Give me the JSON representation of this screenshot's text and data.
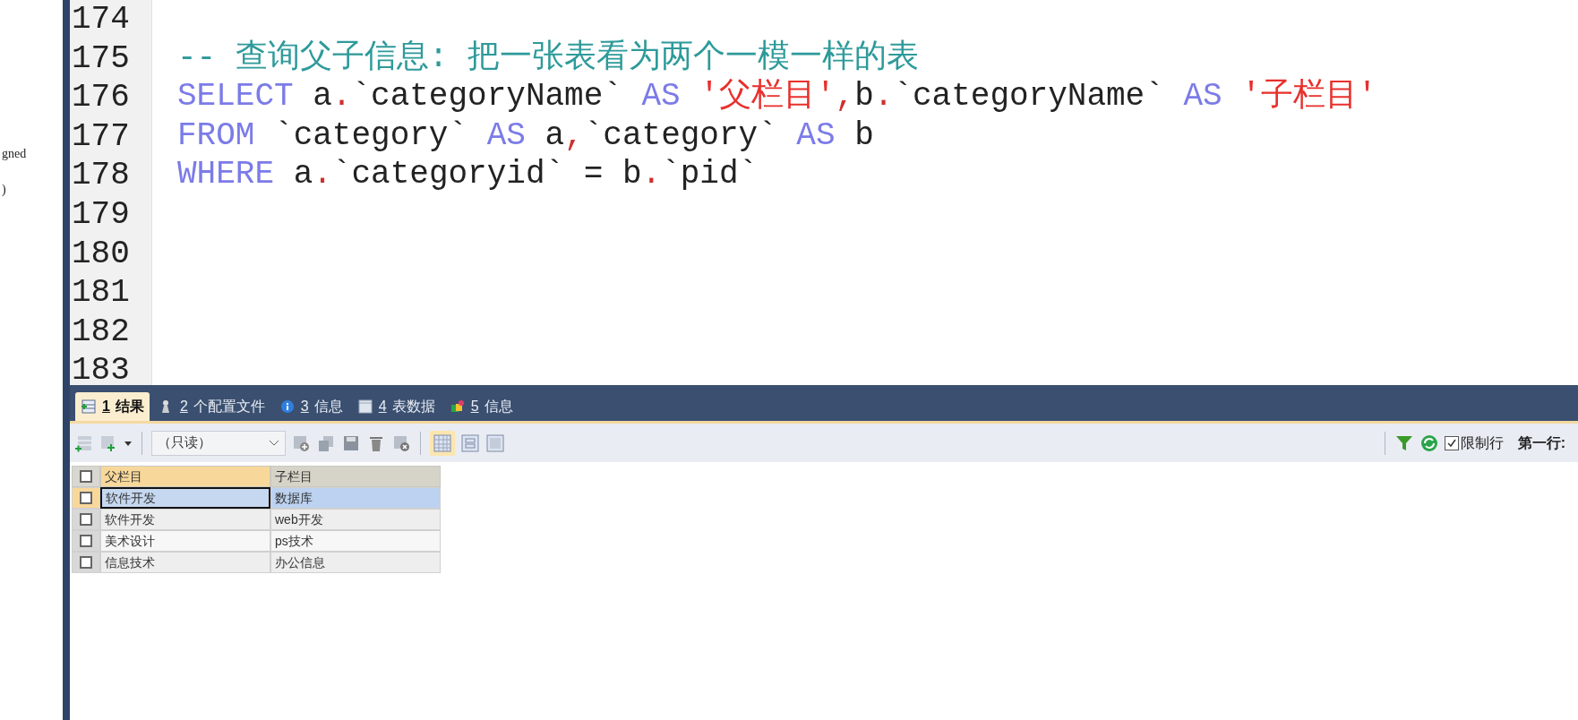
{
  "left_pane": {
    "lines": [
      "gned",
      ")"
    ]
  },
  "editor": {
    "lines": [
      {
        "number": "174"
      },
      {
        "number": "175",
        "tokens": [
          {
            "kind": "comment",
            "text": "-- 查询父子信息: 把一张表看为两个一模一样的表"
          }
        ]
      },
      {
        "number": "176",
        "tokens": [
          {
            "kind": "keyword",
            "text": "SELECT"
          },
          {
            "kind": "plain",
            "text": " a"
          },
          {
            "kind": "punct",
            "text": "."
          },
          {
            "kind": "plain",
            "text": "`categoryName` "
          },
          {
            "kind": "keyword",
            "text": "AS"
          },
          {
            "kind": "string",
            "text": " '父栏目'"
          },
          {
            "kind": "punct",
            "text": ","
          },
          {
            "kind": "plain",
            "text": "b"
          },
          {
            "kind": "punct",
            "text": "."
          },
          {
            "kind": "plain",
            "text": "`categoryName` "
          },
          {
            "kind": "keyword",
            "text": "AS"
          },
          {
            "kind": "string",
            "text": " '子栏目'"
          }
        ]
      },
      {
        "number": "177",
        "tokens": [
          {
            "kind": "keyword",
            "text": "FROM"
          },
          {
            "kind": "plain",
            "text": " `category` "
          },
          {
            "kind": "keyword",
            "text": "AS"
          },
          {
            "kind": "plain",
            "text": " a"
          },
          {
            "kind": "punct",
            "text": ","
          },
          {
            "kind": "plain",
            "text": "`category` "
          },
          {
            "kind": "keyword",
            "text": "AS"
          },
          {
            "kind": "plain",
            "text": " b"
          }
        ]
      },
      {
        "number": "178",
        "tokens": [
          {
            "kind": "keyword",
            "text": "WHERE"
          },
          {
            "kind": "plain",
            "text": " a"
          },
          {
            "kind": "punct",
            "text": "."
          },
          {
            "kind": "plain",
            "text": "`categoryid` = b"
          },
          {
            "kind": "punct",
            "text": "."
          },
          {
            "kind": "plain",
            "text": "`pid`"
          }
        ]
      },
      {
        "number": "179"
      },
      {
        "number": "180"
      },
      {
        "number": "181"
      },
      {
        "number": "182"
      },
      {
        "number": "183"
      }
    ]
  },
  "result_tabs": [
    {
      "kind": "result",
      "accel": "1",
      "label": "结果",
      "selected": true
    },
    {
      "kind": "profile",
      "accel": "2",
      "label": "个配置文件",
      "selected": false
    },
    {
      "kind": "info",
      "accel": "3",
      "label": "信息",
      "selected": false
    },
    {
      "kind": "table",
      "accel": "4",
      "label": "表数据",
      "selected": false
    },
    {
      "kind": "info2",
      "accel": "5",
      "label": "信息",
      "selected": false
    }
  ],
  "toolbar": {
    "mode": "（只读）",
    "limit_rows": {
      "label": "限制行",
      "checked": true
    },
    "first_row_label": "第一行:"
  },
  "table": {
    "header_checked": false,
    "columns": [
      {
        "label": "父栏目",
        "selected": true
      },
      {
        "label": "子栏目",
        "selected": false
      }
    ],
    "rows": [
      {
        "cells": [
          "软件开发",
          "数据库"
        ],
        "selected": true,
        "checked": false
      },
      {
        "cells": [
          "软件开发",
          "web开发"
        ],
        "selected": false,
        "checked": false
      },
      {
        "cells": [
          "美术设计",
          "ps技术"
        ],
        "selected": false,
        "checked": false
      },
      {
        "cells": [
          "信息技术",
          "办公信息"
        ],
        "selected": false,
        "checked": false
      }
    ]
  }
}
